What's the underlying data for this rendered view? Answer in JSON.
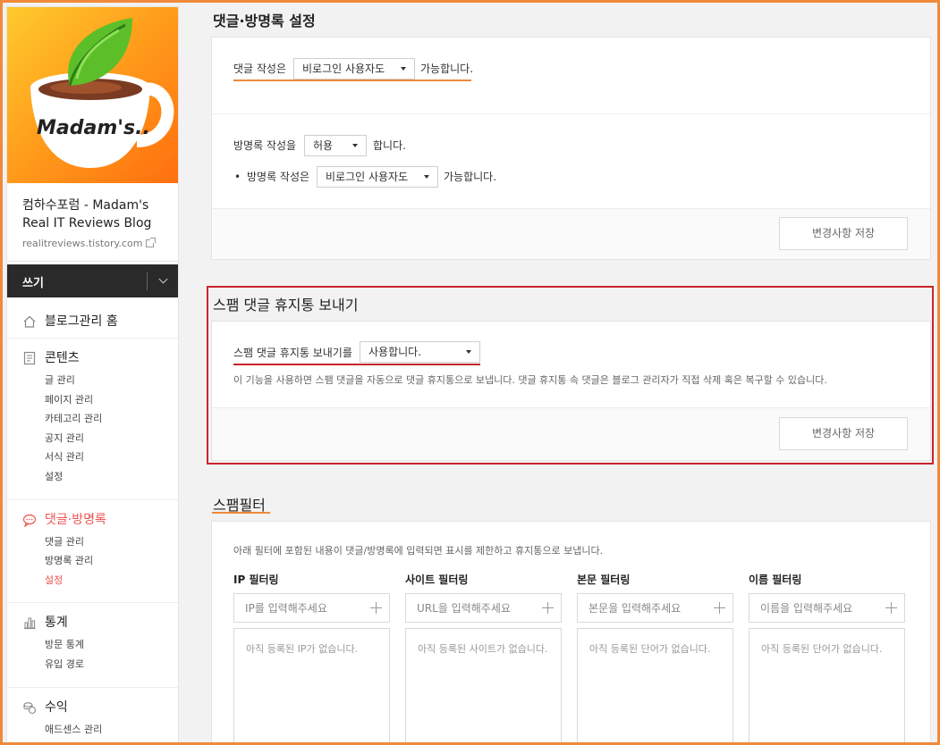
{
  "sidebar": {
    "logo_text": "Madam's..",
    "blog_title": "컴하수포럼 - Madam's Real IT Reviews Blog",
    "blog_url": "realitreviews.tistory.com",
    "write_label": "쓰기",
    "sections": [
      {
        "label": "블로그관리 홈",
        "icon": "home-icon",
        "items": []
      },
      {
        "label": "콘텐츠",
        "icon": "document-icon",
        "items": [
          "글 관리",
          "페이지 관리",
          "카테고리 관리",
          "공지 관리",
          "서식 관리",
          "설정"
        ]
      },
      {
        "label": "댓글·방명록",
        "icon": "comment-icon",
        "active": true,
        "items": [
          "댓글 관리",
          "방명록 관리",
          "설정"
        ],
        "active_item": "설정"
      },
      {
        "label": "통계",
        "icon": "chart-icon",
        "items": [
          "방문 통계",
          "유입 경로"
        ]
      },
      {
        "label": "수익",
        "icon": "coin-icon",
        "items": [
          "애드센스 관리"
        ]
      }
    ]
  },
  "comment_settings": {
    "title": "댓글·방명록 설정",
    "comment_prefix": "댓글 작성은",
    "comment_select": "비로그인 사용자도",
    "comment_suffix": "가능합니다.",
    "guestbook_prefix": "방명록 작성을",
    "guestbook_select": "허용",
    "guestbook_suffix": "합니다.",
    "guestbook_write_bullet": "•",
    "guestbook_write_prefix": "방명록 작성은",
    "guestbook_write_select": "비로그인 사용자도",
    "guestbook_write_suffix": "가능합니다.",
    "save_label": "변경사항 저장"
  },
  "spam_trash": {
    "title": "스팸 댓글 휴지통 보내기",
    "label": "스팸 댓글 휴지통 보내기를",
    "select": "사용합니다.",
    "description": "이 기능을 사용하면 스팸 댓글을 자동으로 댓글 휴지통으로 보냅니다. 댓글 휴지통 속 댓글은 블로그 관리자가 직접 삭제 혹은 복구할 수 있습니다.",
    "save_label": "변경사항 저장"
  },
  "spam_filter": {
    "title": "스팸필터",
    "description": "아래 필터에 포함된 내용이 댓글/방명록에 입력되면 표시를 제한하고 휴지통으로 보냅니다.",
    "filters": [
      {
        "label": "IP 필터링",
        "placeholder": "IP를 입력해주세요",
        "empty": "아직 등록된 IP가 없습니다."
      },
      {
        "label": "사이트 필터링",
        "placeholder": "URL을 입력해주세요",
        "empty": "아직 등록된 사이트가 없습니다."
      },
      {
        "label": "본문 필터링",
        "placeholder": "본문을 입력해주세요",
        "empty": "아직 등록된 단어가 없습니다."
      },
      {
        "label": "이름 필터링",
        "placeholder": "이름을 입력해주세요",
        "empty": "아직 등록된 단어가 없습니다."
      }
    ]
  },
  "colors": {
    "accent_orange": "#f0893a",
    "highlight_red": "#c9252c",
    "active_red": "#ef5350"
  }
}
